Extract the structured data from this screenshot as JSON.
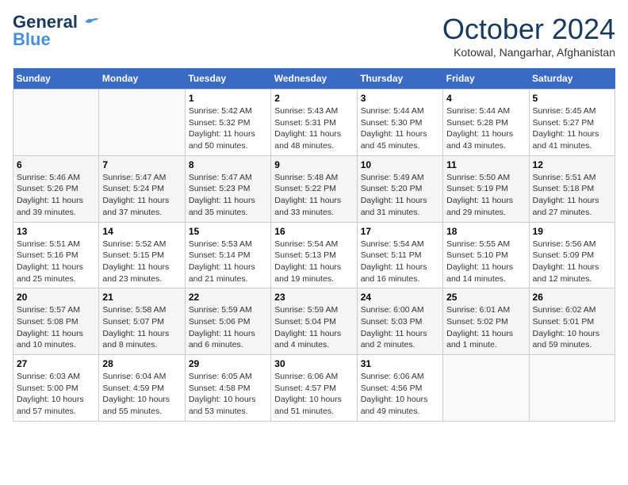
{
  "header": {
    "logo_line1": "General",
    "logo_line2": "Blue",
    "month_title": "October 2024",
    "location": "Kotowal, Nangarhar, Afghanistan"
  },
  "days_of_week": [
    "Sunday",
    "Monday",
    "Tuesday",
    "Wednesday",
    "Thursday",
    "Friday",
    "Saturday"
  ],
  "weeks": [
    [
      {
        "num": "",
        "info": ""
      },
      {
        "num": "",
        "info": ""
      },
      {
        "num": "1",
        "info": "Sunrise: 5:42 AM\nSunset: 5:32 PM\nDaylight: 11 hours and 50 minutes."
      },
      {
        "num": "2",
        "info": "Sunrise: 5:43 AM\nSunset: 5:31 PM\nDaylight: 11 hours and 48 minutes."
      },
      {
        "num": "3",
        "info": "Sunrise: 5:44 AM\nSunset: 5:30 PM\nDaylight: 11 hours and 45 minutes."
      },
      {
        "num": "4",
        "info": "Sunrise: 5:44 AM\nSunset: 5:28 PM\nDaylight: 11 hours and 43 minutes."
      },
      {
        "num": "5",
        "info": "Sunrise: 5:45 AM\nSunset: 5:27 PM\nDaylight: 11 hours and 41 minutes."
      }
    ],
    [
      {
        "num": "6",
        "info": "Sunrise: 5:46 AM\nSunset: 5:26 PM\nDaylight: 11 hours and 39 minutes."
      },
      {
        "num": "7",
        "info": "Sunrise: 5:47 AM\nSunset: 5:24 PM\nDaylight: 11 hours and 37 minutes."
      },
      {
        "num": "8",
        "info": "Sunrise: 5:47 AM\nSunset: 5:23 PM\nDaylight: 11 hours and 35 minutes."
      },
      {
        "num": "9",
        "info": "Sunrise: 5:48 AM\nSunset: 5:22 PM\nDaylight: 11 hours and 33 minutes."
      },
      {
        "num": "10",
        "info": "Sunrise: 5:49 AM\nSunset: 5:20 PM\nDaylight: 11 hours and 31 minutes."
      },
      {
        "num": "11",
        "info": "Sunrise: 5:50 AM\nSunset: 5:19 PM\nDaylight: 11 hours and 29 minutes."
      },
      {
        "num": "12",
        "info": "Sunrise: 5:51 AM\nSunset: 5:18 PM\nDaylight: 11 hours and 27 minutes."
      }
    ],
    [
      {
        "num": "13",
        "info": "Sunrise: 5:51 AM\nSunset: 5:16 PM\nDaylight: 11 hours and 25 minutes."
      },
      {
        "num": "14",
        "info": "Sunrise: 5:52 AM\nSunset: 5:15 PM\nDaylight: 11 hours and 23 minutes."
      },
      {
        "num": "15",
        "info": "Sunrise: 5:53 AM\nSunset: 5:14 PM\nDaylight: 11 hours and 21 minutes."
      },
      {
        "num": "16",
        "info": "Sunrise: 5:54 AM\nSunset: 5:13 PM\nDaylight: 11 hours and 19 minutes."
      },
      {
        "num": "17",
        "info": "Sunrise: 5:54 AM\nSunset: 5:11 PM\nDaylight: 11 hours and 16 minutes."
      },
      {
        "num": "18",
        "info": "Sunrise: 5:55 AM\nSunset: 5:10 PM\nDaylight: 11 hours and 14 minutes."
      },
      {
        "num": "19",
        "info": "Sunrise: 5:56 AM\nSunset: 5:09 PM\nDaylight: 11 hours and 12 minutes."
      }
    ],
    [
      {
        "num": "20",
        "info": "Sunrise: 5:57 AM\nSunset: 5:08 PM\nDaylight: 11 hours and 10 minutes."
      },
      {
        "num": "21",
        "info": "Sunrise: 5:58 AM\nSunset: 5:07 PM\nDaylight: 11 hours and 8 minutes."
      },
      {
        "num": "22",
        "info": "Sunrise: 5:59 AM\nSunset: 5:06 PM\nDaylight: 11 hours and 6 minutes."
      },
      {
        "num": "23",
        "info": "Sunrise: 5:59 AM\nSunset: 5:04 PM\nDaylight: 11 hours and 4 minutes."
      },
      {
        "num": "24",
        "info": "Sunrise: 6:00 AM\nSunset: 5:03 PM\nDaylight: 11 hours and 2 minutes."
      },
      {
        "num": "25",
        "info": "Sunrise: 6:01 AM\nSunset: 5:02 PM\nDaylight: 11 hours and 1 minute."
      },
      {
        "num": "26",
        "info": "Sunrise: 6:02 AM\nSunset: 5:01 PM\nDaylight: 10 hours and 59 minutes."
      }
    ],
    [
      {
        "num": "27",
        "info": "Sunrise: 6:03 AM\nSunset: 5:00 PM\nDaylight: 10 hours and 57 minutes."
      },
      {
        "num": "28",
        "info": "Sunrise: 6:04 AM\nSunset: 4:59 PM\nDaylight: 10 hours and 55 minutes."
      },
      {
        "num": "29",
        "info": "Sunrise: 6:05 AM\nSunset: 4:58 PM\nDaylight: 10 hours and 53 minutes."
      },
      {
        "num": "30",
        "info": "Sunrise: 6:06 AM\nSunset: 4:57 PM\nDaylight: 10 hours and 51 minutes."
      },
      {
        "num": "31",
        "info": "Sunrise: 6:06 AM\nSunset: 4:56 PM\nDaylight: 10 hours and 49 minutes."
      },
      {
        "num": "",
        "info": ""
      },
      {
        "num": "",
        "info": ""
      }
    ]
  ]
}
